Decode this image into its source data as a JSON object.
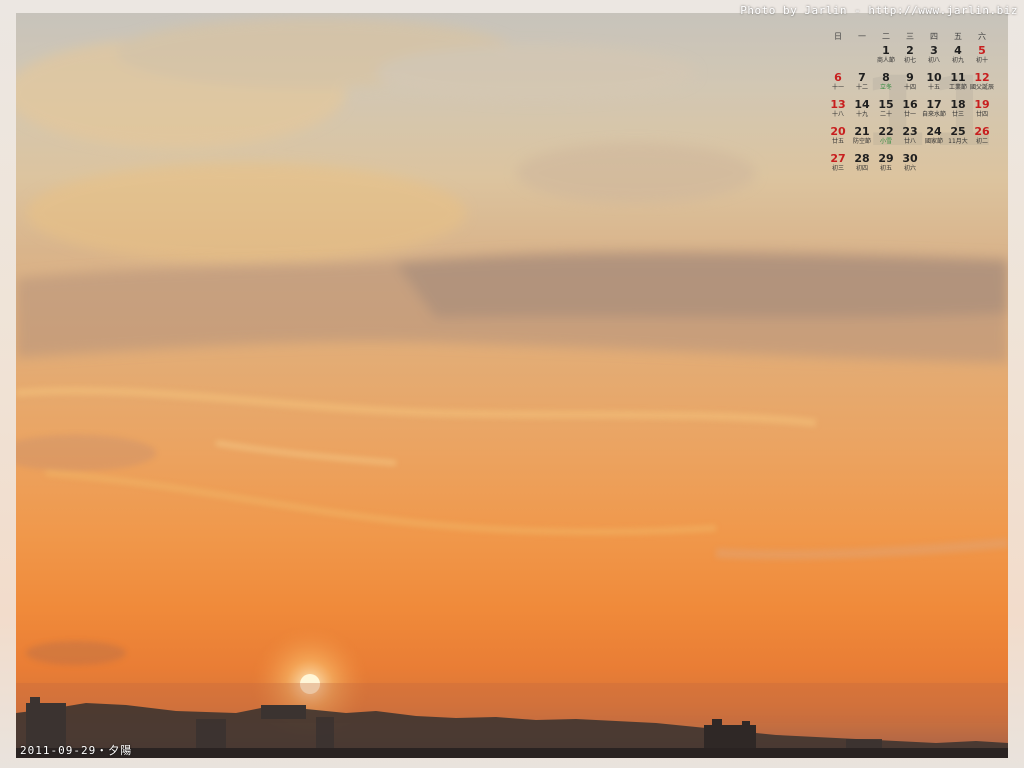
{
  "photo": {
    "credit": "Photo by Jarlin - http://www.jarlin.biz",
    "caption": "2011-09-29・夕陽"
  },
  "calendar": {
    "weekdays": [
      "日",
      "一",
      "二",
      "三",
      "四",
      "五",
      "六"
    ],
    "weeks": [
      [
        {
          "day": "",
          "lunar": ""
        },
        {
          "day": "",
          "lunar": ""
        },
        {
          "day": "",
          "lunar": ""
        },
        {
          "day": "1",
          "lunar": "商人節"
        },
        {
          "day": "2",
          "lunar": "初七"
        },
        {
          "day": "3",
          "lunar": "初八"
        },
        {
          "day": "4",
          "lunar": "初九"
        },
        {
          "day": "5",
          "lunar": "初十",
          "red": true
        }
      ],
      [
        {
          "day": "6",
          "lunar": "十一",
          "red": true
        },
        {
          "day": "7",
          "lunar": "十二"
        },
        {
          "day": "8",
          "lunar": "立冬",
          "lunar_green": true
        },
        {
          "day": "9",
          "lunar": "十四"
        },
        {
          "day": "10",
          "lunar": "十五"
        },
        {
          "day": "11",
          "lunar": "工業節"
        },
        {
          "day": "12",
          "lunar": "國父誕辰",
          "red": true
        }
      ],
      [
        {
          "day": "13",
          "lunar": "十八",
          "red": true
        },
        {
          "day": "14",
          "lunar": "十九"
        },
        {
          "day": "15",
          "lunar": "二十"
        },
        {
          "day": "16",
          "lunar": "廿一"
        },
        {
          "day": "17",
          "lunar": "自來水節"
        },
        {
          "day": "18",
          "lunar": "廿三"
        },
        {
          "day": "19",
          "lunar": "廿四",
          "red": true
        }
      ],
      [
        {
          "day": "20",
          "lunar": "廿五",
          "red": true
        },
        {
          "day": "21",
          "lunar": "防空節"
        },
        {
          "day": "22",
          "lunar": "小雪",
          "lunar_green": true
        },
        {
          "day": "23",
          "lunar": "廿八"
        },
        {
          "day": "24",
          "lunar": "國家節"
        },
        {
          "day": "25",
          "lunar": "11月大"
        },
        {
          "day": "26",
          "lunar": "初二",
          "red": true
        }
      ],
      [
        {
          "day": "27",
          "lunar": "初三",
          "red": true
        },
        {
          "day": "28",
          "lunar": "初四"
        },
        {
          "day": "29",
          "lunar": "初五"
        },
        {
          "day": "30",
          "lunar": "初六"
        },
        {
          "day": "",
          "lunar": ""
        },
        {
          "day": "",
          "lunar": ""
        },
        {
          "day": "",
          "lunar": ""
        }
      ]
    ],
    "month_watermark": "11"
  },
  "colors": {
    "sun": "#fff6d8",
    "sky_top": "#c7c3bb",
    "sky_horizon": "#f08a3a",
    "skyline": "#3b3330",
    "weekend_red": "#c81e1e",
    "solar_term_green": "#2f8a3c"
  }
}
